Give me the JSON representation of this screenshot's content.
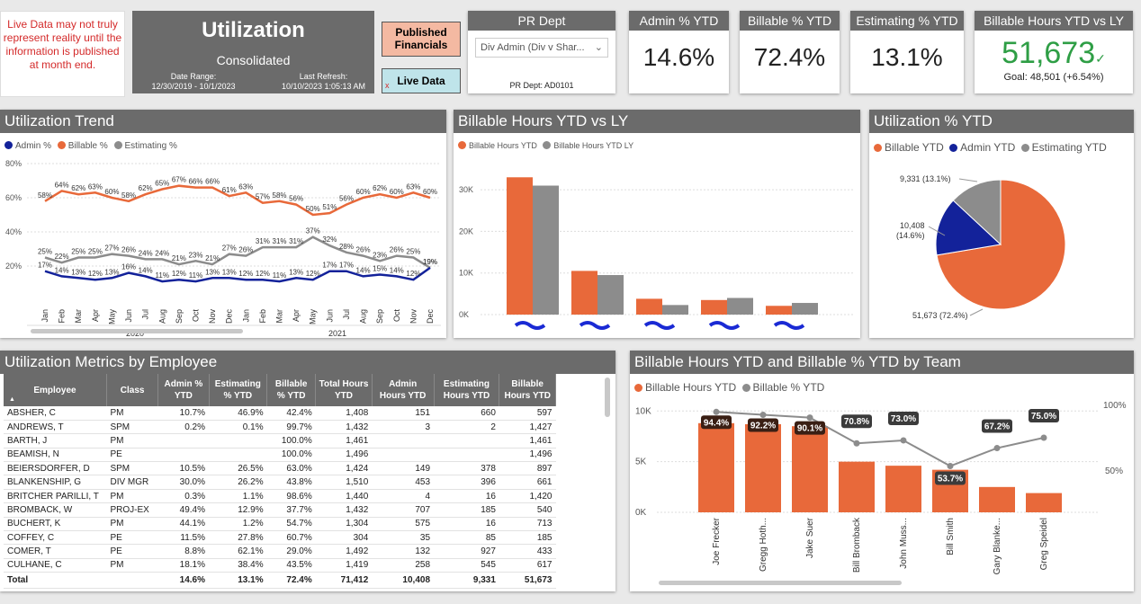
{
  "warning": {
    "text": "Live Data may not truly represent reality until the information is published at month end."
  },
  "header": {
    "title": "Utilization",
    "subtitle": "Consolidated",
    "date_range_label": "Date Range:",
    "date_range_value": "12/30/2019 - 10/1/2023",
    "refresh_label": "Last Refresh:",
    "refresh_value": "10/10/2023 1:05:13 AM"
  },
  "buttons": {
    "published": "Published Financials",
    "live": "Live Data",
    "live_mark": "x"
  },
  "pr_dept": {
    "title": "PR Dept",
    "selected": "Div Admin (Div v Shar...",
    "code": "PR Dept: AD0101"
  },
  "kpis": {
    "admin": {
      "title": "Admin % YTD",
      "value": "14.6%"
    },
    "billable": {
      "title": "Billable % YTD",
      "value": "72.4%"
    },
    "estimating": {
      "title": "Estimating % YTD",
      "value": "13.1%"
    },
    "hours": {
      "title": "Billable Hours YTD vs LY",
      "value": "51,673",
      "goal": "Goal: 48,501 (+6.54%)",
      "check": "✓"
    }
  },
  "colors": {
    "admin": "#13229a",
    "billable": "#e8693a",
    "estimating": "#8c8c8c",
    "header": "#6b6b6b",
    "good": "#2e9e45"
  },
  "trend": {
    "title": "Utilization Trend",
    "legend": [
      "Admin %",
      "Billable %",
      "Estimating %"
    ],
    "years": [
      "2020",
      "2021"
    ]
  },
  "billable_ly": {
    "title": "Billable Hours YTD vs LY",
    "legend": [
      "Billable Hours YTD",
      "Billable Hours YTD LY"
    ]
  },
  "pie": {
    "title": "Utilization % YTD",
    "legend": [
      "Billable YTD",
      "Admin YTD",
      "Estimating YTD"
    ],
    "labels": {
      "estimating": "9,331 (13.1%)",
      "admin1": "10,408",
      "admin2": "(14.6%)",
      "billable": "51,673 (72.4%)"
    }
  },
  "metrics": {
    "title": "Utilization Metrics by Employee",
    "sort_icon": "▲",
    "columns": [
      "Employee",
      "Class",
      "Admin % YTD",
      "Estimating % YTD",
      "Billable % YTD",
      "Total Hours YTD",
      "Admin Hours YTD",
      "Estimating Hours YTD",
      "Billable Hours YTD"
    ],
    "rows": [
      [
        "ABSHER, C",
        "PM",
        "10.7%",
        "46.9%",
        "42.4%",
        "1,408",
        "151",
        "660",
        "597"
      ],
      [
        "ANDREWS, T",
        "SPM",
        "0.2%",
        "0.1%",
        "99.7%",
        "1,432",
        "3",
        "2",
        "1,427"
      ],
      [
        "BARTH, J",
        "PM",
        "",
        "",
        "100.0%",
        "1,461",
        "",
        "",
        "1,461"
      ],
      [
        "BEAMISH, N",
        "PE",
        "",
        "",
        "100.0%",
        "1,496",
        "",
        "",
        "1,496"
      ],
      [
        "BEIERSDORFER, D",
        "SPM",
        "10.5%",
        "26.5%",
        "63.0%",
        "1,424",
        "149",
        "378",
        "897"
      ],
      [
        "BLANKENSHIP, G",
        "DIV MGR",
        "30.0%",
        "26.2%",
        "43.8%",
        "1,510",
        "453",
        "396",
        "661"
      ],
      [
        "BRITCHER PARILLI, T",
        "PM",
        "0.3%",
        "1.1%",
        "98.6%",
        "1,440",
        "4",
        "16",
        "1,420"
      ],
      [
        "BROMBACK, W",
        "PROJ-EX",
        "49.4%",
        "12.9%",
        "37.7%",
        "1,432",
        "707",
        "185",
        "540"
      ],
      [
        "BUCHERT, K",
        "PM",
        "44.1%",
        "1.2%",
        "54.7%",
        "1,304",
        "575",
        "16",
        "713"
      ],
      [
        "COFFEY, C",
        "PE",
        "11.5%",
        "27.8%",
        "60.7%",
        "304",
        "35",
        "85",
        "185"
      ],
      [
        "COMER, T",
        "PE",
        "8.8%",
        "62.1%",
        "29.0%",
        "1,492",
        "132",
        "927",
        "433"
      ],
      [
        "CULHANE, C",
        "PM",
        "18.1%",
        "38.4%",
        "43.5%",
        "1,419",
        "258",
        "545",
        "617"
      ]
    ],
    "total": [
      "Total",
      "",
      "14.6%",
      "13.1%",
      "72.4%",
      "71,412",
      "10,408",
      "9,331",
      "51,673"
    ]
  },
  "team": {
    "title": "Billable Hours YTD and Billable % YTD by Team",
    "legend": [
      "Billable Hours YTD",
      "Billable % YTD"
    ]
  },
  "chart_data": [
    {
      "type": "line",
      "title": "Utilization Trend",
      "categories": [
        "Jan",
        "Feb",
        "Mar",
        "Apr",
        "May",
        "Jun",
        "Jul",
        "Aug",
        "Sep",
        "Oct",
        "Nov",
        "Dec",
        "Jan",
        "Feb",
        "Mar",
        "Apr",
        "May",
        "Jun",
        "Jul",
        "Aug",
        "Sep",
        "Oct",
        "Nov",
        "Dec"
      ],
      "ylim": [
        0,
        80
      ],
      "yticks": [
        "20%",
        "40%",
        "60%",
        "80%"
      ],
      "series": [
        {
          "name": "Billable %",
          "values": [
            58,
            64,
            62,
            63,
            60,
            58,
            62,
            65,
            67,
            66,
            66,
            61,
            63,
            57,
            58,
            56,
            50,
            51,
            56,
            60,
            62,
            60,
            63,
            60
          ]
        },
        {
          "name": "Estimating %",
          "values": [
            25,
            22,
            25,
            25,
            27,
            26,
            24,
            24,
            21,
            23,
            21,
            27,
            26,
            31,
            31,
            31,
            37,
            32,
            28,
            26,
            23,
            26,
            25,
            19
          ]
        },
        {
          "name": "Admin %",
          "values": [
            17,
            14,
            13,
            12,
            13,
            16,
            14,
            11,
            12,
            11,
            13,
            13,
            12,
            12,
            11,
            13,
            12,
            17,
            17,
            14,
            15,
            14,
            12,
            19
          ]
        }
      ],
      "labels": {
        "Billable %": [
          "58%",
          "64%",
          "62%",
          "63%",
          "60%",
          "58%",
          "62%",
          "65%",
          "67%",
          "66%",
          "66%",
          "61%",
          "63%",
          "57%",
          "58%",
          "56%",
          "50%",
          "51%",
          "56%",
          "60%",
          "62%",
          "60%",
          "63%",
          "60%"
        ],
        "Estimating %": [
          "25%",
          "22%",
          "25%",
          "25%",
          "27%",
          "26%",
          "24%",
          "24%",
          "21%",
          "23%",
          "21%",
          "27%",
          "26%",
          "31%",
          "31%",
          "31%",
          "37%",
          "32%",
          "28%",
          "26%",
          "23%",
          "26%",
          "25%",
          "19%"
        ],
        "Admin %": [
          "17%",
          "14%",
          "13%",
          "12%",
          "13%",
          "16%",
          "14%",
          "11%",
          "12%",
          "11%",
          "13%",
          "13%",
          "12%",
          "12%",
          "11%",
          "13%",
          "12%",
          "17%",
          "17%",
          "14%",
          "15%",
          "14%",
          "12%",
          "19%"
        ]
      }
    },
    {
      "type": "bar",
      "title": "Billable Hours YTD vs LY",
      "ylim": [
        0,
        35000
      ],
      "yticks": [
        "0K",
        "10K",
        "20K",
        "30K"
      ],
      "series": [
        {
          "name": "Billable Hours YTD",
          "values": [
            33000,
            10500,
            3800,
            3500,
            2100
          ]
        },
        {
          "name": "Billable Hours YTD LY",
          "values": [
            31000,
            9500,
            2300,
            4000,
            2800
          ]
        }
      ]
    },
    {
      "type": "pie",
      "title": "Utilization % YTD",
      "slices": [
        {
          "name": "Billable YTD",
          "value": 51673,
          "pct": 72.4
        },
        {
          "name": "Admin YTD",
          "value": 10408,
          "pct": 14.6
        },
        {
          "name": "Estimating YTD",
          "value": 9331,
          "pct": 13.1
        }
      ]
    },
    {
      "type": "bar",
      "title": "Billable Hours YTD and Billable % YTD by Team",
      "categories": [
        "Joe Frecker",
        "Gregg Hoth...",
        "Jake Suer",
        "Bill Bromback",
        "John Muss...",
        "Bill Smith",
        "Gary Blanke...",
        "Greg Speidel"
      ],
      "ylim": [
        0,
        11000
      ],
      "yticks": [
        "0K",
        "5K",
        "10K"
      ],
      "y2ticks": [
        "50%",
        "100%"
      ],
      "series": [
        {
          "name": "Billable Hours YTD",
          "values": [
            8800,
            8700,
            8500,
            5000,
            4600,
            4200,
            2500,
            1900
          ]
        },
        {
          "name": "Billable % YTD",
          "values": [
            94.4,
            92.2,
            90.1,
            70.8,
            73.0,
            53.7,
            67.2,
            75.0
          ],
          "labels": [
            "94.4%",
            "92.2%",
            "90.1%",
            "70.8%",
            "73.0%",
            "53.7%",
            "67.2%",
            "75.0%"
          ]
        }
      ]
    }
  ]
}
